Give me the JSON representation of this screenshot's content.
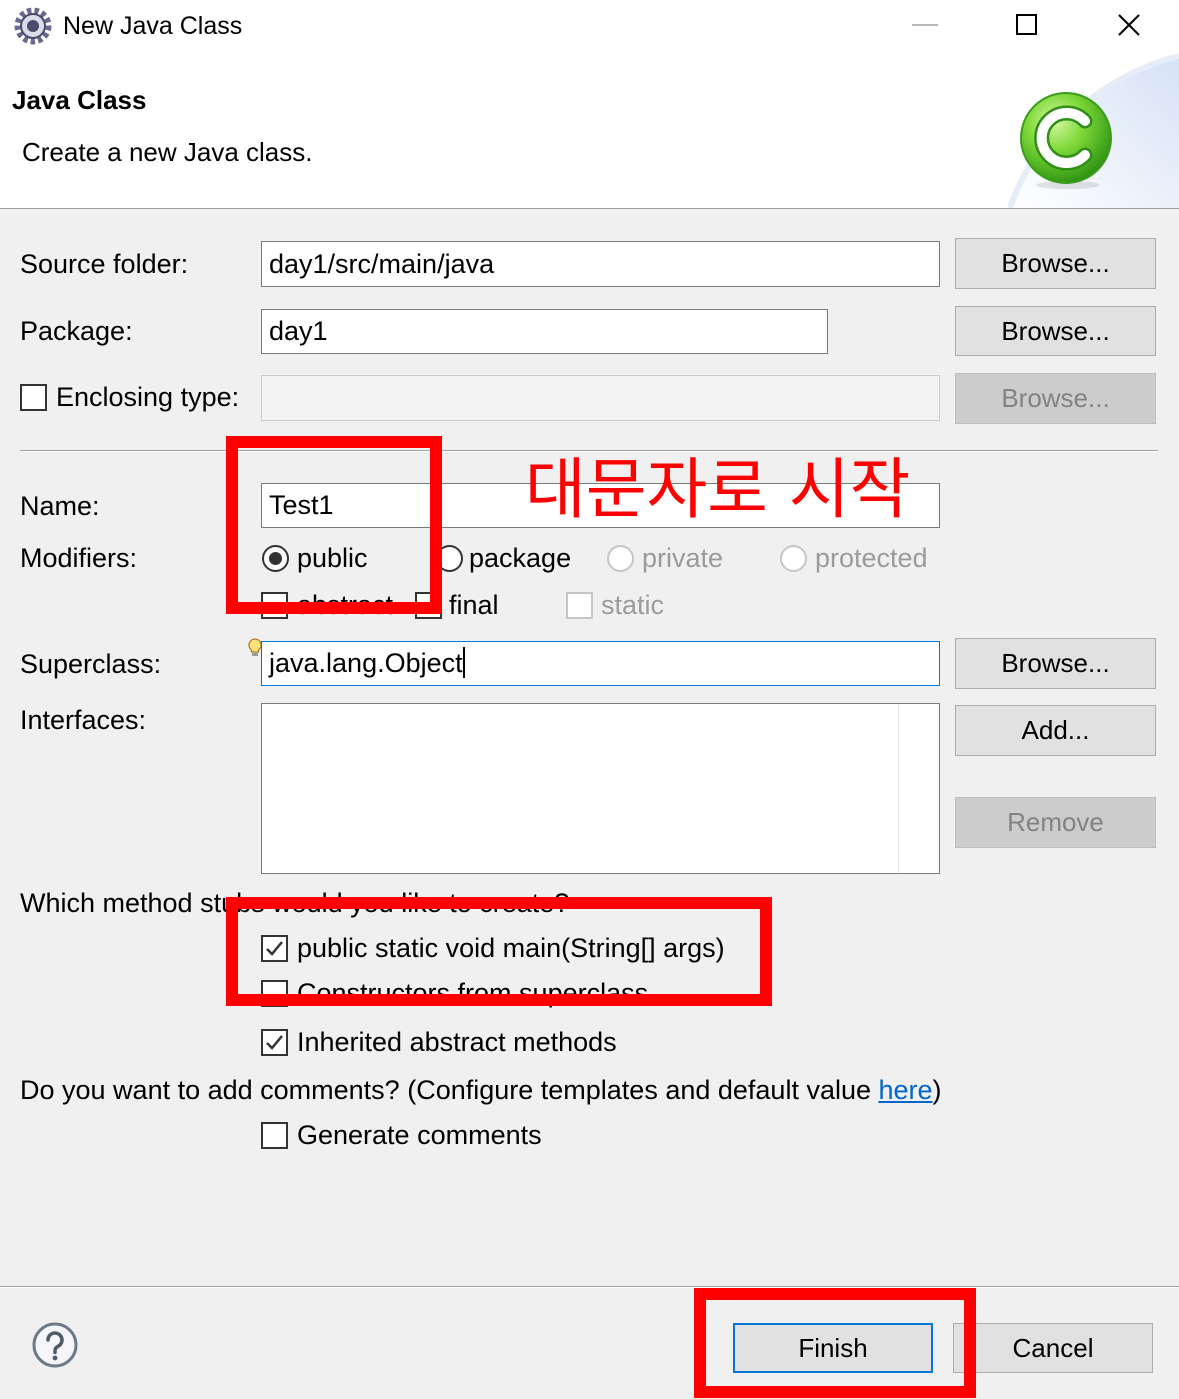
{
  "window": {
    "title": "New Java Class",
    "app_icon": "eclipse-app-icon",
    "minimize_icon": "minimize-icon",
    "maximize_icon": "maximize-icon",
    "close_icon": "close-icon"
  },
  "header": {
    "title": "Java Class",
    "description": "Create a new Java class.",
    "banner_icon": "new-java-class-icon"
  },
  "form": {
    "source_folder": {
      "label": "Source folder:",
      "value": "day1/src/main/java",
      "browse_label": "Browse..."
    },
    "package": {
      "label": "Package:",
      "value": "day1",
      "browse_label": "Browse..."
    },
    "enclosing_type": {
      "label": "Enclosing type:",
      "checked": false,
      "field_disabled": true,
      "browse_label": "Browse..."
    },
    "name": {
      "label": "Name:",
      "value": "Test1"
    },
    "modifiers": {
      "label": "Modifiers:",
      "access": [
        {
          "label": "public",
          "selected": true,
          "disabled": false
        },
        {
          "label": "package",
          "selected": false,
          "disabled": false
        },
        {
          "label": "private",
          "selected": false,
          "disabled": true
        },
        {
          "label": "protected",
          "selected": false,
          "disabled": true
        }
      ],
      "flags": [
        {
          "label": "abstract",
          "checked": false,
          "disabled": false
        },
        {
          "label": "final",
          "checked": false,
          "disabled": false
        },
        {
          "label": "static",
          "checked": false,
          "disabled": true
        }
      ]
    },
    "superclass": {
      "label": "Superclass:",
      "value": "java.lang.Object",
      "browse_label": "Browse...",
      "assist_icon": "content-assist-bulb-icon",
      "focused": true
    },
    "interfaces": {
      "label": "Interfaces:",
      "items": [],
      "add_label": "Add...",
      "remove_label": "Remove",
      "remove_disabled": true
    },
    "method_stubs": {
      "question": "Which method stubs would you like to create?",
      "options": [
        {
          "label": "public static void main(String[] args)",
          "checked": true
        },
        {
          "label": "Constructors from superclass",
          "checked": false
        },
        {
          "label": "Inherited abstract methods",
          "checked": true
        }
      ]
    },
    "comments": {
      "question_prefix": "Do you want to add comments? (Configure templates and default value ",
      "link_label": "here",
      "question_suffix": ")",
      "generate": {
        "label": "Generate comments",
        "checked": false
      }
    }
  },
  "footer": {
    "help_icon": "help-icon",
    "finish_label": "Finish",
    "cancel_label": "Cancel"
  },
  "annotation": {
    "color": "#ff0000",
    "note": "대문자로 시작"
  },
  "colors": {
    "accent": "#0078d7",
    "link": "#0066cc",
    "dialog_bg": "#f0f0f0"
  }
}
